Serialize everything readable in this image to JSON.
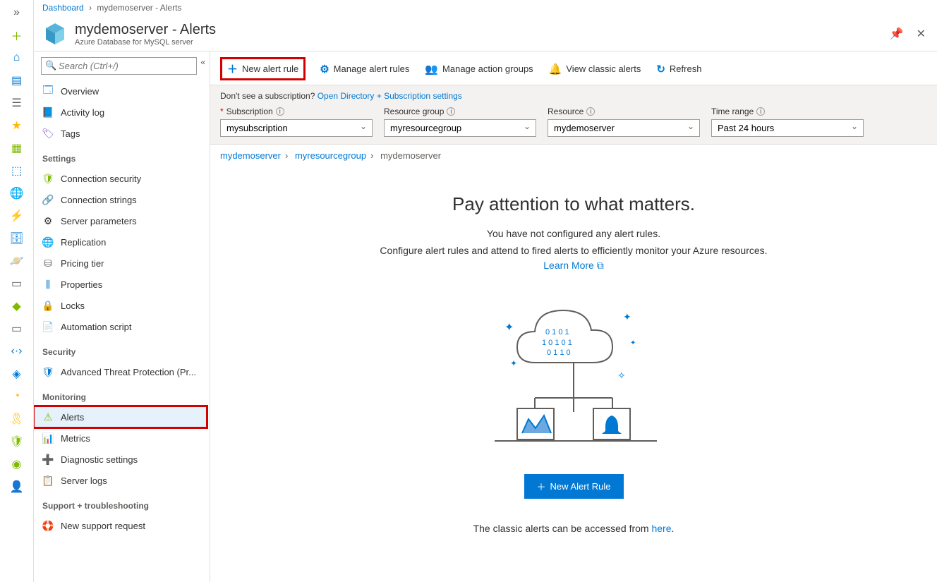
{
  "breadcrumb": {
    "root": "Dashboard",
    "current": "mydemoserver - Alerts"
  },
  "header": {
    "title": "mydemoserver - Alerts",
    "subtitle": "Azure Database for MySQL server"
  },
  "search": {
    "placeholder": "Search (Ctrl+/)"
  },
  "sidebar": {
    "overview": "Overview",
    "activity_log": "Activity log",
    "tags": "Tags",
    "sections": {
      "settings": "Settings",
      "security": "Security",
      "monitoring": "Monitoring",
      "support": "Support + troubleshooting"
    },
    "settings": {
      "connection_security": "Connection security",
      "connection_strings": "Connection strings",
      "server_parameters": "Server parameters",
      "replication": "Replication",
      "pricing_tier": "Pricing tier",
      "properties": "Properties",
      "locks": "Locks",
      "automation_script": "Automation script"
    },
    "security_items": {
      "atp": "Advanced Threat Protection (Pr..."
    },
    "monitoring": {
      "alerts": "Alerts",
      "metrics": "Metrics",
      "diagnostic": "Diagnostic settings",
      "server_logs": "Server logs"
    },
    "support": {
      "new_request": "New support request"
    }
  },
  "toolbar": {
    "new_alert_rule": "New alert rule",
    "manage_alert_rules": "Manage alert rules",
    "manage_action_groups": "Manage action groups",
    "view_classic": "View classic alerts",
    "refresh": "Refresh"
  },
  "filter": {
    "note_prefix": "Don't see a subscription? ",
    "note_link": "Open Directory + Subscription settings",
    "subscription_label": "Subscription",
    "resource_group_label": "Resource group",
    "resource_label": "Resource",
    "time_range_label": "Time range",
    "subscription_value": "mysubscription",
    "resource_group_value": "myresourcegroup",
    "resource_value": "mydemoserver",
    "time_range_value": "Past 24 hours"
  },
  "crumb2": {
    "a": "mydemoserver",
    "b": "myresourcegroup",
    "c": "mydemoserver"
  },
  "empty": {
    "heading": "Pay attention to what matters.",
    "line1": "You have not configured any alert rules.",
    "desc": "Configure alert rules and attend to fired alerts to efficiently monitor your Azure resources. ",
    "learn_more": "Learn More",
    "button": "New Alert Rule",
    "classic_prefix": "The classic alerts can be accessed from ",
    "classic_link": "here"
  }
}
